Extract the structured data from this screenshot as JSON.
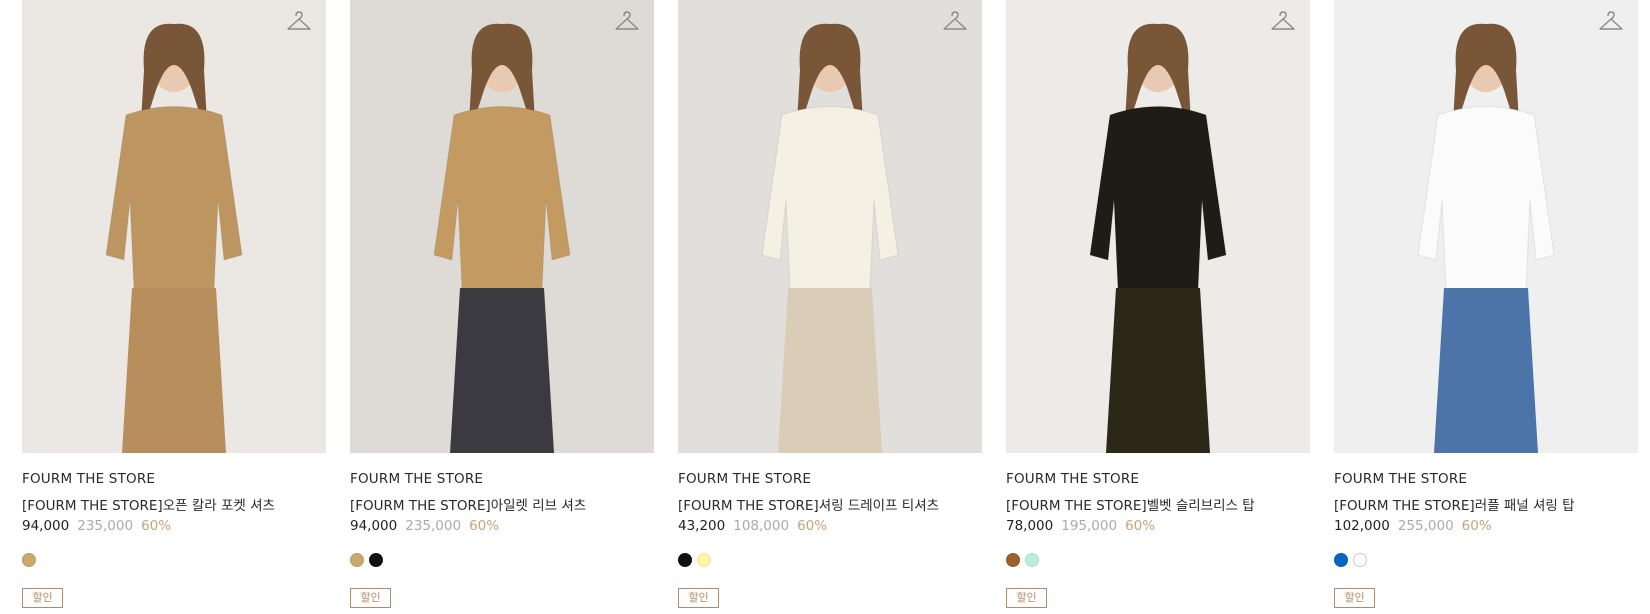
{
  "products": [
    {
      "brand": "FOURM THE STORE",
      "name": "[FOURM THE STORE]오픈 칼라 포켓 셔츠",
      "price": "94,000",
      "original_price": "235,000",
      "discount": "60%",
      "swatches": [
        "#c9a86a"
      ],
      "badge": "할인",
      "photo_bg": "#ebe7e2",
      "outfit_color": "#bd9561",
      "outfit_lower": "#b88f5c"
    },
    {
      "brand": "FOURM THE STORE",
      "name": "[FOURM THE STORE]아일렛 리브 셔츠",
      "price": "94,000",
      "original_price": "235,000",
      "discount": "60%",
      "swatches": [
        "#c9a86a",
        "#111111"
      ],
      "badge": "할인",
      "photo_bg": "#dedbd7",
      "outfit_color": "#c29a62",
      "outfit_lower": "#3a3a40"
    },
    {
      "brand": "FOURM THE STORE",
      "name": "[FOURM THE STORE]셔링 드레이프 티셔츠",
      "price": "43,200",
      "original_price": "108,000",
      "discount": "60%",
      "swatches": [
        "#111111",
        "#fbf7a6"
      ],
      "badge": "할인",
      "photo_bg": "#e1dfdc",
      "outfit_color": "#f4f0e3",
      "outfit_lower": "#d9cdb7"
    },
    {
      "brand": "FOURM THE STORE",
      "name": "[FOURM THE STORE]벨벳 슬리브리스 탑",
      "price": "78,000",
      "original_price": "195,000",
      "discount": "60%",
      "swatches": [
        "#a0602c",
        "#b9f0d8"
      ],
      "badge": "할인",
      "photo_bg": "#ecebe8",
      "outfit_color": "#1e1c14",
      "outfit_lower": "#2b2818"
    },
    {
      "brand": "FOURM THE STORE",
      "name": "[FOURM THE STORE]러플 패널 셔링 탑",
      "price": "102,000",
      "original_price": "255,000",
      "discount": "60%",
      "swatches": [
        "#0b64c0",
        "#ffffff"
      ],
      "badge": "할인",
      "photo_bg": "#efefef",
      "outfit_color": "#fbfbfb",
      "outfit_lower": "#4d74a8"
    }
  ]
}
